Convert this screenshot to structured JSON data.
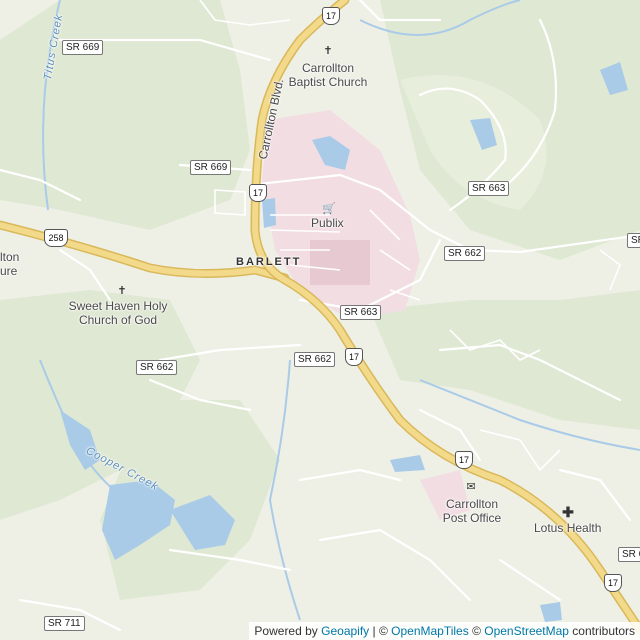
{
  "map": {
    "place_label": "BARLETT",
    "road_label": "Carrollton Blvd.",
    "route_shields": {
      "sr669_top": "SR 669",
      "sr669_mid": "SR 669",
      "sr663_right": "SR 663",
      "sr663_mid": "SR 663",
      "sr662_right": "SR 662",
      "sr662_left": "SR 662",
      "sr662_center": "SR 662",
      "sr711": "SR 711",
      "sr_edge_top": "SR",
      "sr_edge_bottom": "SR 6"
    },
    "us_shields": {
      "us17_top": "17",
      "us17_north": "17",
      "us17_center": "17",
      "us17_southeast": "17",
      "us17_bottom": "17",
      "us258": "258"
    },
    "pois": {
      "baptist_church": "Carrollton Baptist Church",
      "publix": "Publix",
      "sweet_haven": "Sweet Haven Holy Church of God",
      "post_office": "Carrollton Post Office",
      "lotus_health": "Lotus Health",
      "edge_label_1": "lton",
      "edge_label_2": "ure"
    },
    "water": {
      "titus_creek": "Titus Creek",
      "cooper_creek": "Cooper Creek"
    },
    "colors": {
      "land": "#eef0e6",
      "forest": "#dfe8d3",
      "water": "#a9cbe8",
      "highway": "#f3d98a",
      "highway_casing": "#d9b85a",
      "minor_road": "#ffffff",
      "commercial": "#f2dde3"
    }
  },
  "attribution": {
    "prefix": "Powered by",
    "geoapify": "Geoapify",
    "sep1": " | © ",
    "omt": "OpenMapTiles",
    "sep2": " © ",
    "osm": "OpenStreetMap",
    "suffix": " contributors"
  }
}
